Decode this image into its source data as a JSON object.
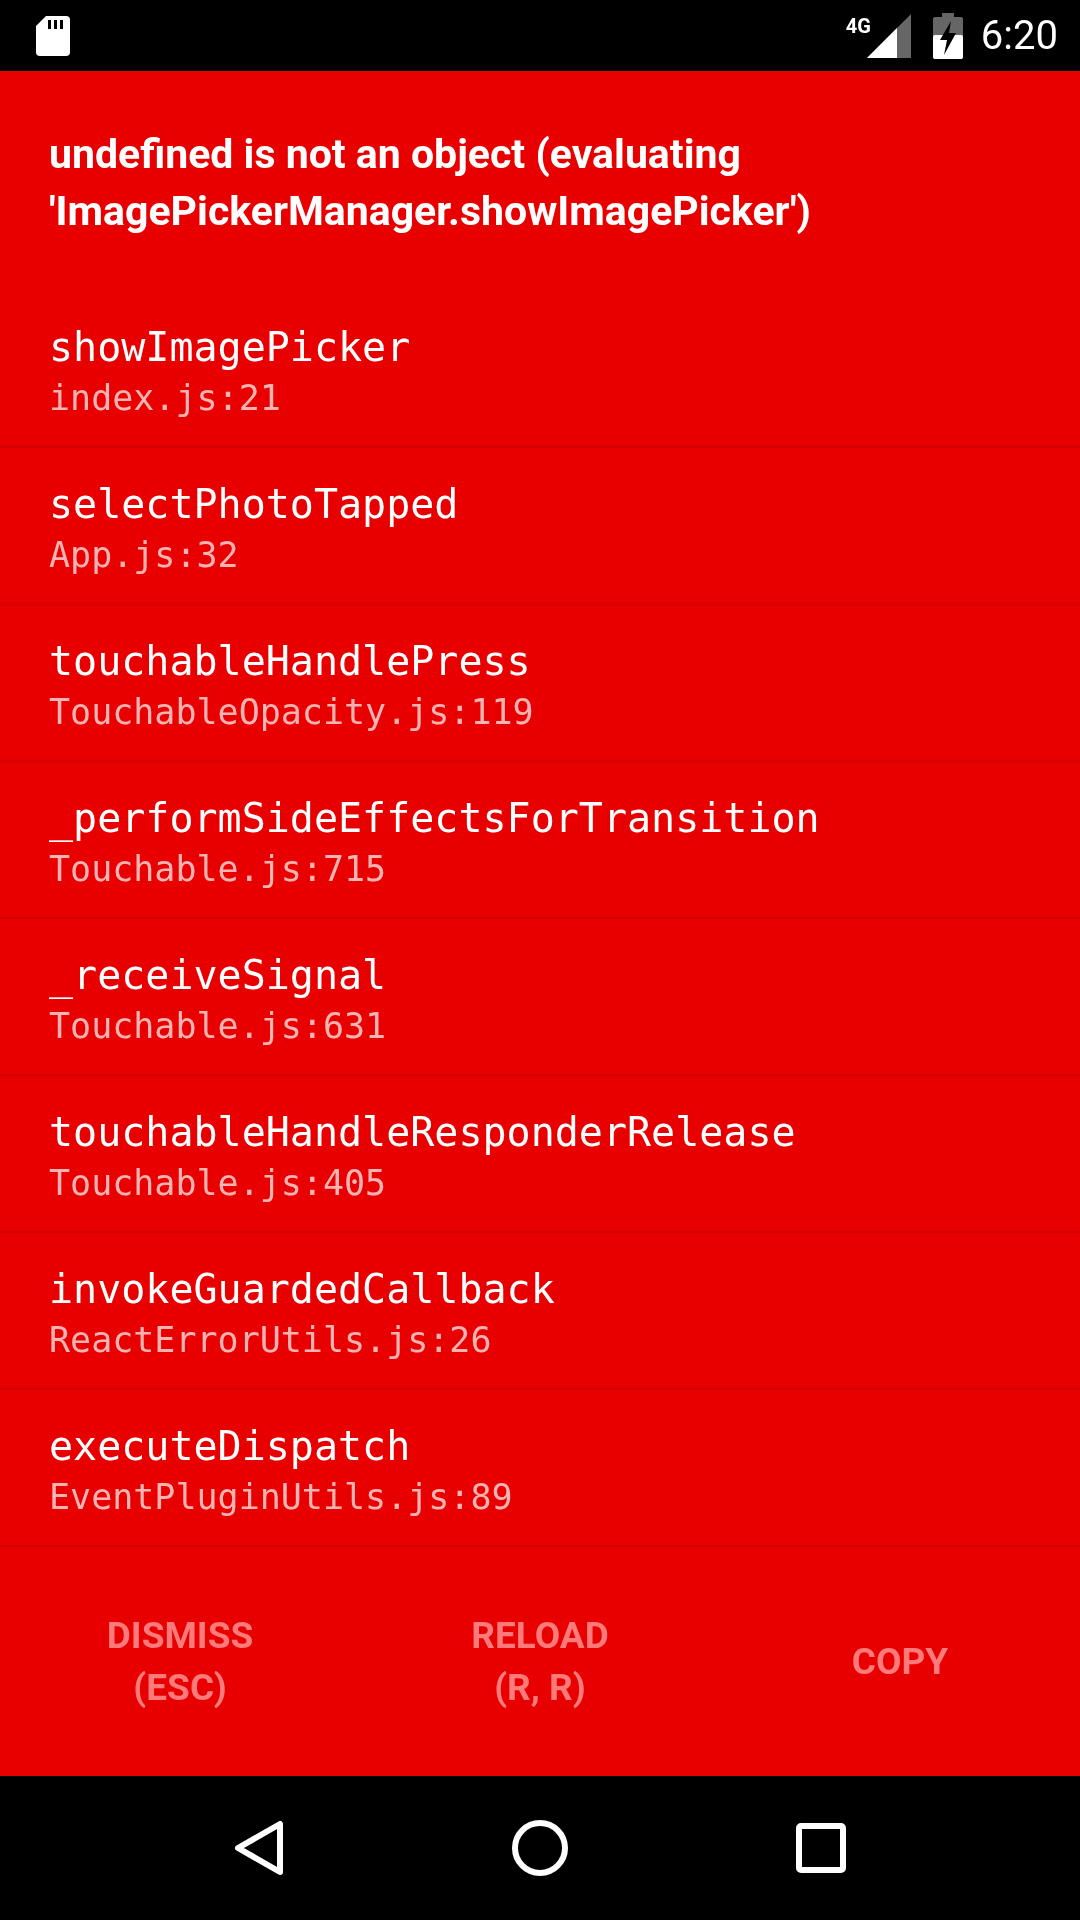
{
  "status_bar": {
    "network": "4G",
    "time": "6:20"
  },
  "error": {
    "message": "undefined is not an object (evaluating 'ImagePickerManager.showImagePicker')"
  },
  "stack_frames": [
    {
      "method": "showImagePicker",
      "location": "index.js:21"
    },
    {
      "method": "selectPhotoTapped",
      "location": "App.js:32"
    },
    {
      "method": "touchableHandlePress",
      "location": "TouchableOpacity.js:119"
    },
    {
      "method": "_performSideEffectsForTransition",
      "location": "Touchable.js:715"
    },
    {
      "method": "_receiveSignal",
      "location": "Touchable.js:631"
    },
    {
      "method": "touchableHandleResponderRelease",
      "location": "Touchable.js:405"
    },
    {
      "method": "invokeGuardedCallback",
      "location": "ReactErrorUtils.js:26"
    },
    {
      "method": "executeDispatch",
      "location": "EventPluginUtils.js:89"
    }
  ],
  "buttons": [
    {
      "label": "DISMISS\n(ESC)"
    },
    {
      "label": "RELOAD\n(R, R)"
    },
    {
      "label": "COPY"
    }
  ]
}
